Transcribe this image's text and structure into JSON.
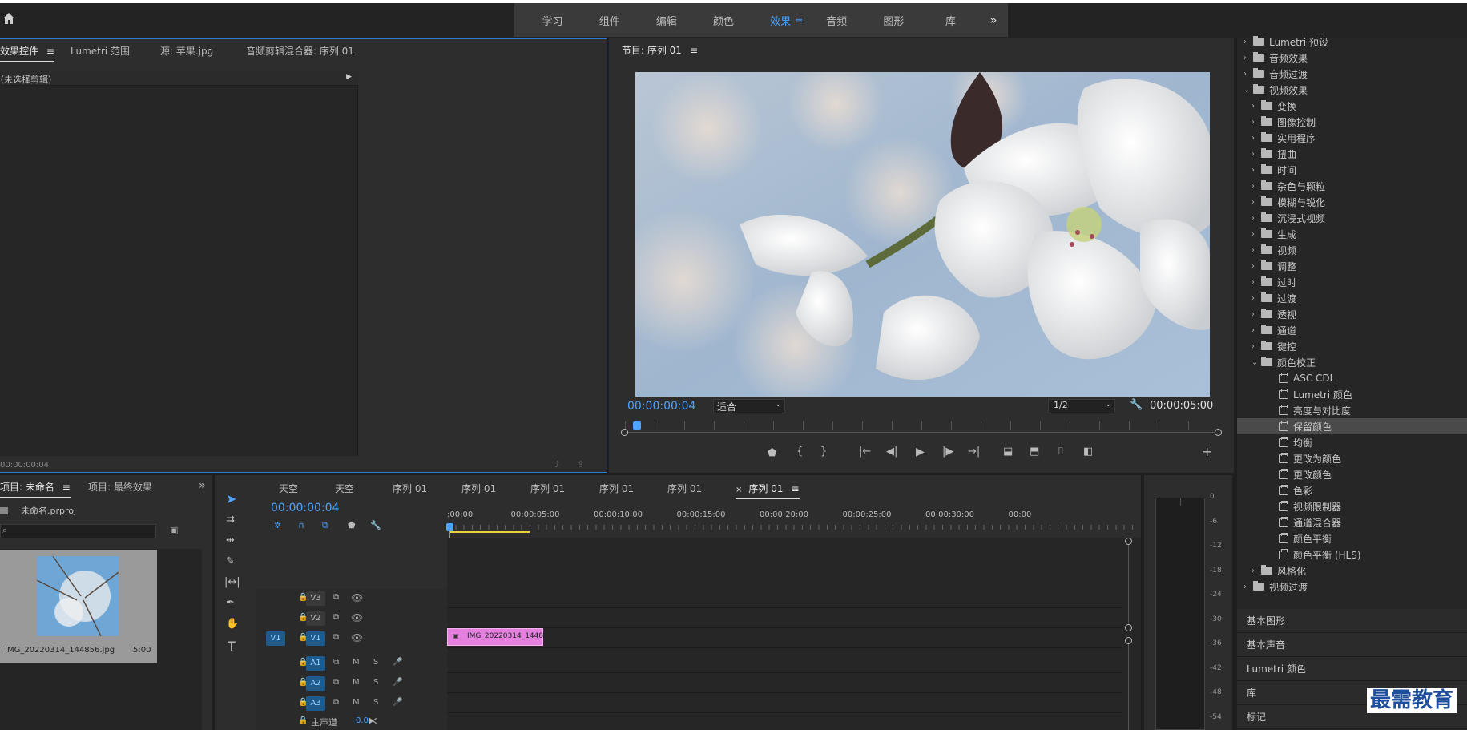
{
  "topbar": {
    "workspaces": [
      "学习",
      "组件",
      "编辑",
      "颜色",
      "效果",
      "音频",
      "图形",
      "库"
    ],
    "active": "效果",
    "menu_glyph": "≡",
    "more_glyph": "»"
  },
  "effect_controls": {
    "tabs": [
      "效果控件",
      "Lumetri 范围",
      "源: 苹果.jpg",
      "音频剪辑混合器: 序列 01"
    ],
    "menu_glyph": "≡",
    "no_clip": "（未选择剪辑）",
    "timecode": "00:00:00:04"
  },
  "program": {
    "title": "节目: 序列 01",
    "menu_glyph": "≡",
    "timecode": "00:00:00:04",
    "fit": "适合",
    "resolution": "1/2",
    "duration": "00:00:05:00",
    "playhead_fraction": 0.02
  },
  "project": {
    "tabs": [
      "项目: 未命名",
      "项目: 最终效果"
    ],
    "menu_glyph": "≡",
    "more_glyph": "»",
    "file": "未命名.prproj",
    "search_placeholder": "",
    "clip_name": "IMG_20220314_144856.jpg",
    "clip_duration": "5:00"
  },
  "timeline": {
    "tabs": [
      "天空",
      "天空",
      "序列 01",
      "序列 01",
      "序列 01",
      "序列 01",
      "序列 01",
      "序列 01"
    ],
    "active_tab": 7,
    "close_glyph": "×",
    "menu_glyph": "≡",
    "timecode": "00:00:00:04",
    "ruler": [
      ":00:00",
      "00:00:05:00",
      "00:00:10:00",
      "00:00:15:00",
      "00:00:20:00",
      "00:00:25:00",
      "00:00:30:00",
      "00:00"
    ],
    "video_tracks": [
      "V3",
      "V2",
      "V1"
    ],
    "audio_tracks": [
      "A1",
      "A2",
      "A3"
    ],
    "source_patch": "V1",
    "mute": "M",
    "solo": "S",
    "master": "主声道",
    "master_value": "0.0",
    "clip_label": "IMG_20220314_1448"
  },
  "meter": {
    "ticks": [
      "0",
      "-6",
      "-12",
      "-18",
      "-24",
      "-30",
      "-36",
      "-42",
      "-48",
      "-54"
    ]
  },
  "effects_panel": {
    "top_item": "Lumetri 预设",
    "groups": [
      {
        "label": "音频效果",
        "level": 0,
        "open": false
      },
      {
        "label": "音频过渡",
        "level": 0,
        "open": false
      },
      {
        "label": "视频效果",
        "level": 0,
        "open": true
      },
      {
        "label": "变换",
        "level": 1,
        "open": false
      },
      {
        "label": "图像控制",
        "level": 1,
        "open": false
      },
      {
        "label": "实用程序",
        "level": 1,
        "open": false
      },
      {
        "label": "扭曲",
        "level": 1,
        "open": false
      },
      {
        "label": "时间",
        "level": 1,
        "open": false
      },
      {
        "label": "杂色与颗粒",
        "level": 1,
        "open": false
      },
      {
        "label": "模糊与锐化",
        "level": 1,
        "open": false
      },
      {
        "label": "沉浸式视频",
        "level": 1,
        "open": false
      },
      {
        "label": "生成",
        "level": 1,
        "open": false
      },
      {
        "label": "视频",
        "level": 1,
        "open": false
      },
      {
        "label": "调整",
        "level": 1,
        "open": false
      },
      {
        "label": "过时",
        "level": 1,
        "open": false
      },
      {
        "label": "过渡",
        "level": 1,
        "open": false
      },
      {
        "label": "透视",
        "level": 1,
        "open": false
      },
      {
        "label": "通道",
        "level": 1,
        "open": false
      },
      {
        "label": "键控",
        "level": 1,
        "open": false
      },
      {
        "label": "颜色校正",
        "level": 1,
        "open": true
      }
    ],
    "color_effects": [
      "ASC CDL",
      "Lumetri 颜色",
      "亮度与对比度",
      "保留颜色",
      "均衡",
      "更改为颜色",
      "更改颜色",
      "色彩",
      "视频限制器",
      "通道混合器",
      "颜色平衡",
      "颜色平衡 (HLS)"
    ],
    "selected": "保留颜色",
    "after": [
      {
        "label": "风格化",
        "level": 1
      },
      {
        "label": "视频过渡",
        "level": 0
      }
    ],
    "sections": [
      "基本图形",
      "基本声音",
      "Lumetri 颜色",
      "库",
      "标记"
    ]
  },
  "watermark": "最需教育",
  "colors": {
    "accent": "#4da3ff",
    "clip": "#e57fe0",
    "selected_row": "#4a4a4a"
  }
}
